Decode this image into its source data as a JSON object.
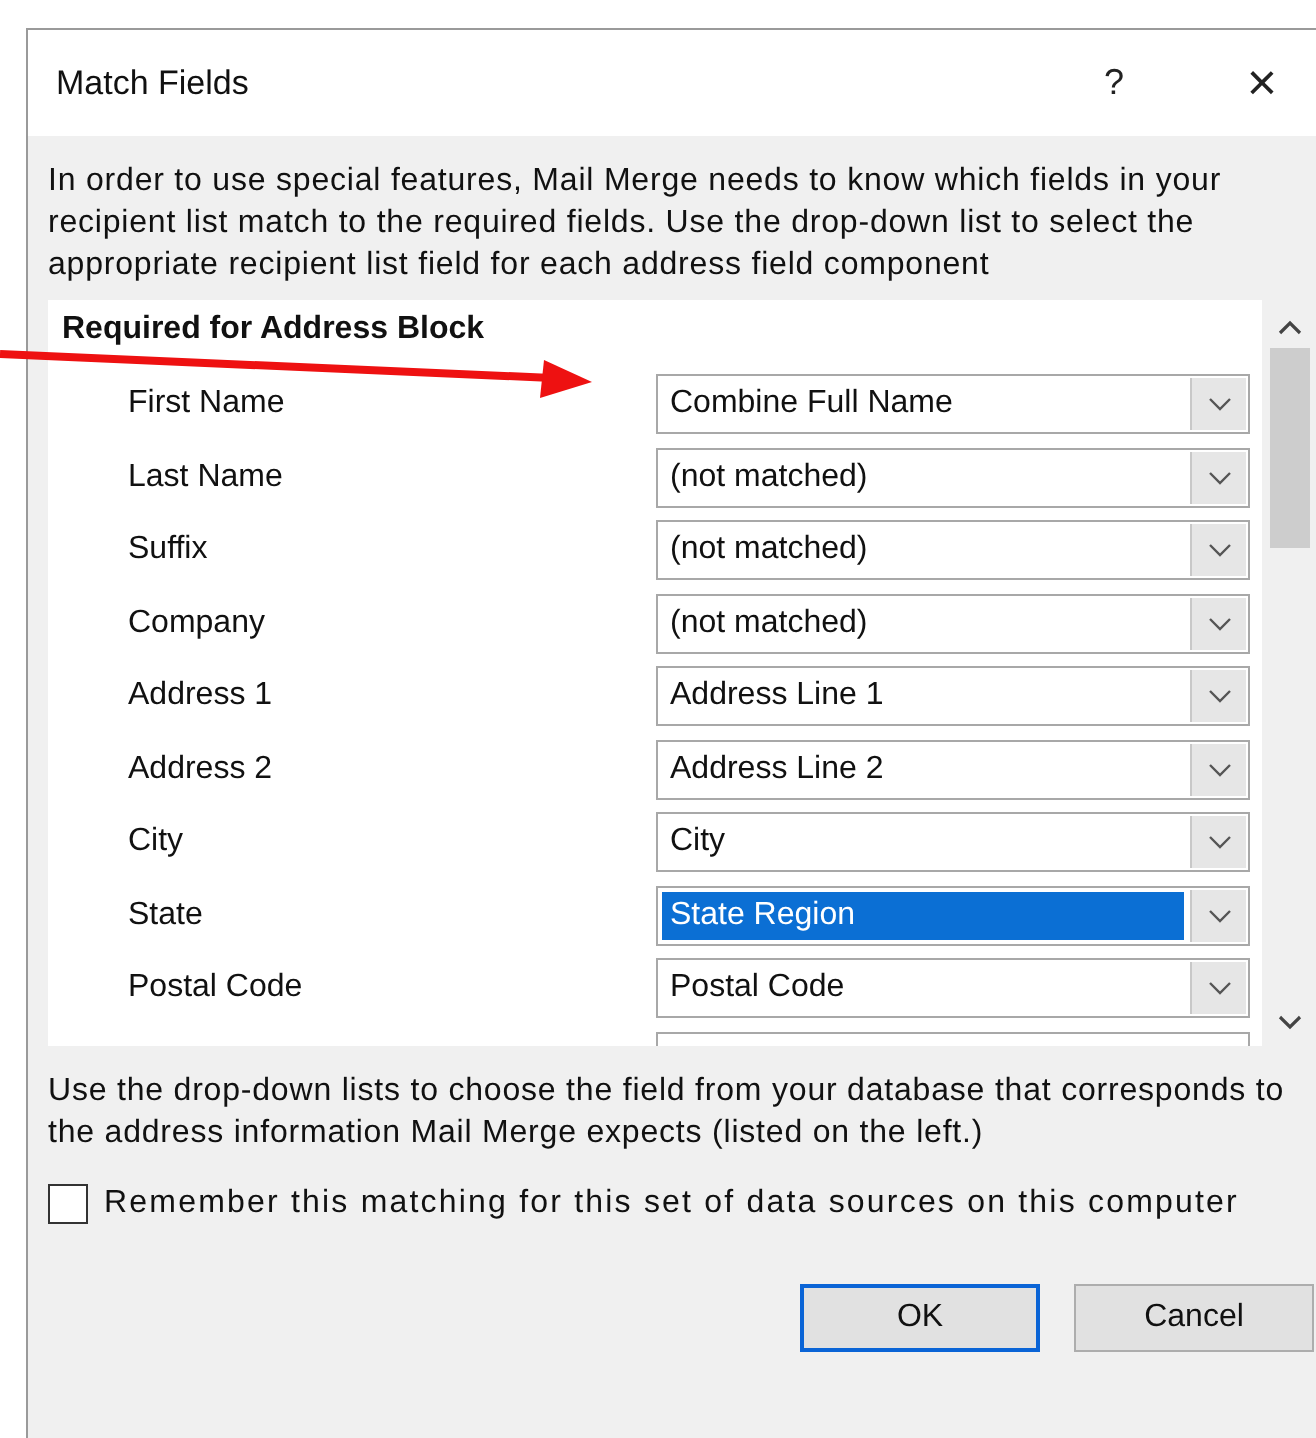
{
  "window": {
    "title": "Match Fields",
    "help": "?",
    "close": "×"
  },
  "intro": "In order to use special features, Mail Merge needs to know which fields in your recipient list match to the required fields.  Use the drop-down list to select the appropriate recipient list field for each address field component",
  "section": "Required for Address Block",
  "rows": [
    {
      "label": "First Name",
      "value": "Combine Full Name",
      "selected": false
    },
    {
      "label": "Last Name",
      "value": "(not matched)",
      "selected": false
    },
    {
      "label": "Suffix",
      "value": "(not matched)",
      "selected": false
    },
    {
      "label": "Company",
      "value": "(not matched)",
      "selected": false
    },
    {
      "label": "Address 1",
      "value": "Address Line 1",
      "selected": false
    },
    {
      "label": "Address 2",
      "value": "Address Line 2",
      "selected": false
    },
    {
      "label": "City",
      "value": "City",
      "selected": false
    },
    {
      "label": "State",
      "value": "State Region",
      "selected": true
    },
    {
      "label": "Postal Code",
      "value": "Postal Code",
      "selected": false
    }
  ],
  "hint": "Use the drop-down lists to choose the field from your database that corresponds to the address information Mail Merge expects (listed on the left.)",
  "remember": {
    "label": "Remember this matching for this set of data sources on this computer",
    "checked": false
  },
  "buttons": [
    {
      "label": "OK",
      "default": true
    },
    {
      "label": "Cancel",
      "default": false
    }
  ]
}
